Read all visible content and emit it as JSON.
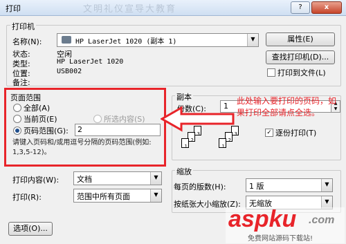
{
  "window": {
    "title": "打印",
    "ghost_title": "文明礼仪宣导大教育",
    "help": "?",
    "close": "x"
  },
  "printer": {
    "group": "打印机",
    "name_label": "名称(N):",
    "name_value": "HP LaserJet 1020 (副本 1)",
    "properties_button": "属性(E)",
    "find_button": "查找打印机(D)...",
    "print_to_file": "打印到文件(L)",
    "status_label": "状态:",
    "status_value": "空闲",
    "type_label": "类型:",
    "type_value": "HP LaserJet 1020",
    "where_label": "位置:",
    "where_value": "USB002",
    "comment_label": "备注:"
  },
  "page_range": {
    "group": "页面范围",
    "all": "全部(A)",
    "current": "当前页(E)",
    "selection": "所选内容(S)",
    "pages": "页码范围(G):",
    "pages_value": "2",
    "hint": "请键入页码和/或用逗号分隔的页码范围(例如: 1,3,5-12)。"
  },
  "copies": {
    "group": "副本",
    "count_label": "份数(C):",
    "count_value": "1",
    "collate": "逐份打印(T)",
    "pages_icon": [
      "1",
      "2",
      "3",
      "1",
      "2",
      "3"
    ]
  },
  "annotation": "此处输入要打印的页码，如果打印全部请点全选。",
  "print_what": {
    "label": "打印内容(W):",
    "value": "文档"
  },
  "print_sel": {
    "label": "打印(R):",
    "value": "范围中所有页面"
  },
  "zoom": {
    "group": "缩放",
    "pages_per_sheet_label": "每页的版数(H):",
    "pages_per_sheet_value": "1 版",
    "scale_label": "按纸张大小缩放(Z):",
    "scale_value": "无缩放"
  },
  "options_button": "选项(O)...",
  "watermark": {
    "brand": "aspku",
    "tld": ".com",
    "sub": "免费网站源码下载站!"
  }
}
